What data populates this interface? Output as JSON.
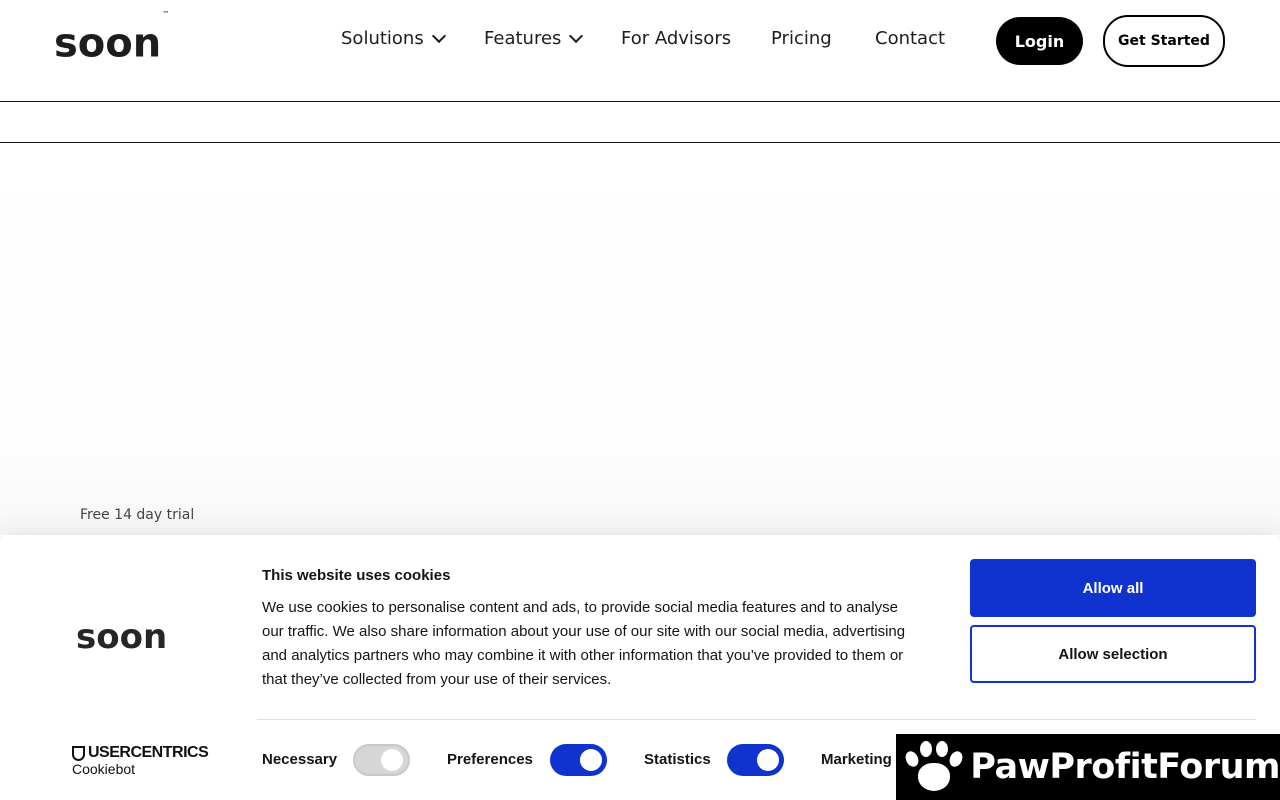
{
  "header": {
    "logo": "soon",
    "logo_tm": "™",
    "nav": [
      {
        "label": "Solutions",
        "dropdown": true
      },
      {
        "label": "Features",
        "dropdown": true
      },
      {
        "label": "For Advisors",
        "dropdown": false
      },
      {
        "label": "Pricing",
        "dropdown": false
      },
      {
        "label": "Contact",
        "dropdown": false
      }
    ],
    "login_label": "Login",
    "get_started_label": "Get Started"
  },
  "hero": {
    "trial_text": "Free 14 day trial"
  },
  "cookie_banner": {
    "logo": "soon",
    "provider_name": "USERCENTRICS",
    "provider_sub": "Cookiebot",
    "title": "This website uses cookies",
    "body": "We use cookies to personalise content and ads, to provide social media features and to analyse our traffic. We also share information about your use of our site with our social media, advertising and analytics partners who may combine it with other information that you’ve provided to them or that they’ve collected from your use of their services.",
    "allow_all_label": "Allow all",
    "allow_selection_label": "Allow selection",
    "toggles": [
      {
        "label": "Necessary",
        "state": "on-disabled"
      },
      {
        "label": "Preferences",
        "state": "on"
      },
      {
        "label": "Statistics",
        "state": "on"
      },
      {
        "label": "Marketing",
        "state": "on"
      }
    ],
    "accent_color": "#1032cf"
  },
  "watermark": {
    "text": "PawProfitForum"
  }
}
